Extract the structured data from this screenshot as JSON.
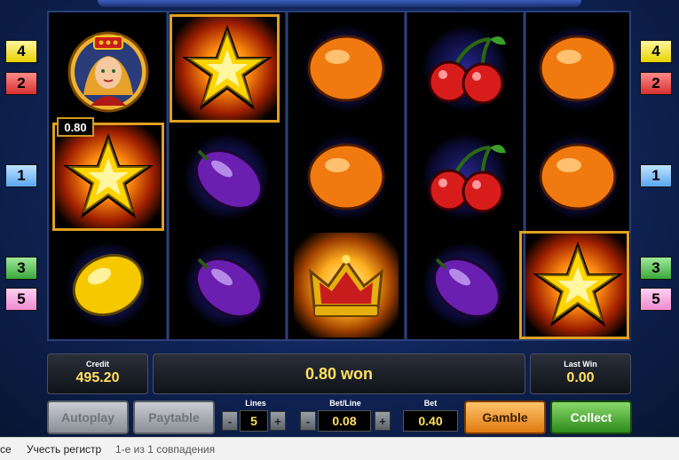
{
  "line_badges": {
    "left": [
      {
        "label": "4",
        "color": "yellow"
      },
      {
        "label": "2",
        "color": "red"
      },
      {
        "label": "1",
        "color": "blue"
      },
      {
        "label": "3",
        "color": "green"
      },
      {
        "label": "5",
        "color": "pink"
      }
    ],
    "right": [
      {
        "label": "4",
        "color": "yellow"
      },
      {
        "label": "2",
        "color": "red"
      },
      {
        "label": "1",
        "color": "blue"
      },
      {
        "label": "3",
        "color": "green"
      },
      {
        "label": "5",
        "color": "pink"
      }
    ]
  },
  "reels": [
    [
      "queen",
      "star",
      "lemon"
    ],
    [
      "star",
      "plum",
      "plum"
    ],
    [
      "orange",
      "orange",
      "crown"
    ],
    [
      "cherries",
      "cherries",
      "plum"
    ],
    [
      "orange",
      "orange",
      "star"
    ]
  ],
  "winning_symbols": [
    "reel1-row2",
    "reel2-row1",
    "reel5-row3"
  ],
  "win_tag": "0.80",
  "credit": {
    "label": "Credit",
    "value": "495.20"
  },
  "message": "0.80 won",
  "last_win": {
    "label": "Last Win",
    "value": "0.00"
  },
  "buttons": {
    "autoplay": "Autoplay",
    "paytable": "Paytable",
    "gamble": "Gamble",
    "collect": "Collect"
  },
  "lines": {
    "label": "Lines",
    "value": "5"
  },
  "bet_line": {
    "label": "Bet/Line",
    "value": "0.08"
  },
  "bet": {
    "label": "Bet",
    "value": "0.40"
  },
  "stepper": {
    "minus": "-",
    "plus": "+"
  },
  "findbar": {
    "close": "се",
    "match_case": "Учесть регистр",
    "status": "1-е из 1 совпадения"
  },
  "colors": {
    "win_frame": "#e0a020",
    "value_text": "#ffe060",
    "gamble": "#f09a30",
    "collect": "#3aa83a"
  }
}
